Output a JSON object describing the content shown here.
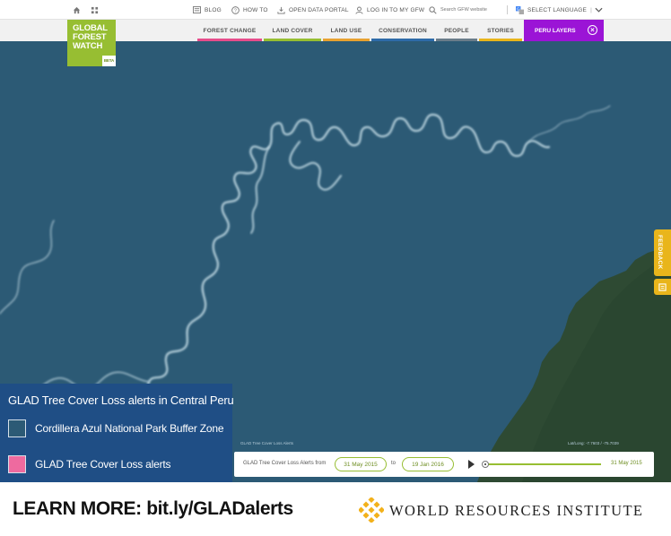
{
  "topbar": {
    "blog": "BLOG",
    "how_to": "HOW TO",
    "open_data": "OPEN DATA PORTAL",
    "login": "LOG IN TO MY GFW",
    "search_placeholder": "Search GFW website",
    "language": "SELECT LANGUAGE"
  },
  "logo": {
    "line1": "GLOBAL",
    "line2": "FOREST",
    "line3": "WATCH",
    "beta": "BETA"
  },
  "nav": {
    "tabs": [
      {
        "label": "FOREST CHANGE",
        "color": "#e74d8b"
      },
      {
        "label": "LAND COVER",
        "color": "#97be32"
      },
      {
        "label": "LAND USE",
        "color": "#e8a130"
      },
      {
        "label": "CONSERVATION",
        "color": "#2e6ba8"
      },
      {
        "label": "PEOPLE",
        "color": "#6a7c8a"
      },
      {
        "label": "STORIES",
        "color": "#e9b51b"
      }
    ],
    "active_tab": {
      "label": "PERU LAYERS",
      "color": "#9b14d6"
    }
  },
  "feedback": {
    "label": "FEEDBACK"
  },
  "timeline": {
    "label": "GLAD Tree Cover Loss Alerts from",
    "from": "31 May 2015",
    "to_word": "to",
    "to": "19 Jan 2016",
    "current": "31 May 2015"
  },
  "map": {
    "attribution": "GLAD Tree Cover Loss Alerts",
    "scale": "Lat/Long: -7.7603 / -75.7039"
  },
  "legend": {
    "title": "GLAD Tree Cover Loss alerts in Central Peru",
    "items": [
      {
        "label": "Cordillera Azul National Park Buffer Zone",
        "color": "#2c5a75"
      },
      {
        "label": "GLAD Tree Cover Loss alerts",
        "color": "#ee6a9f"
      }
    ]
  },
  "footer": {
    "learn_more": "LEARN MORE: bit.ly/GLADalerts",
    "org": "WORLD RESOURCES INSTITUTE",
    "accent": "#f2b11b"
  }
}
